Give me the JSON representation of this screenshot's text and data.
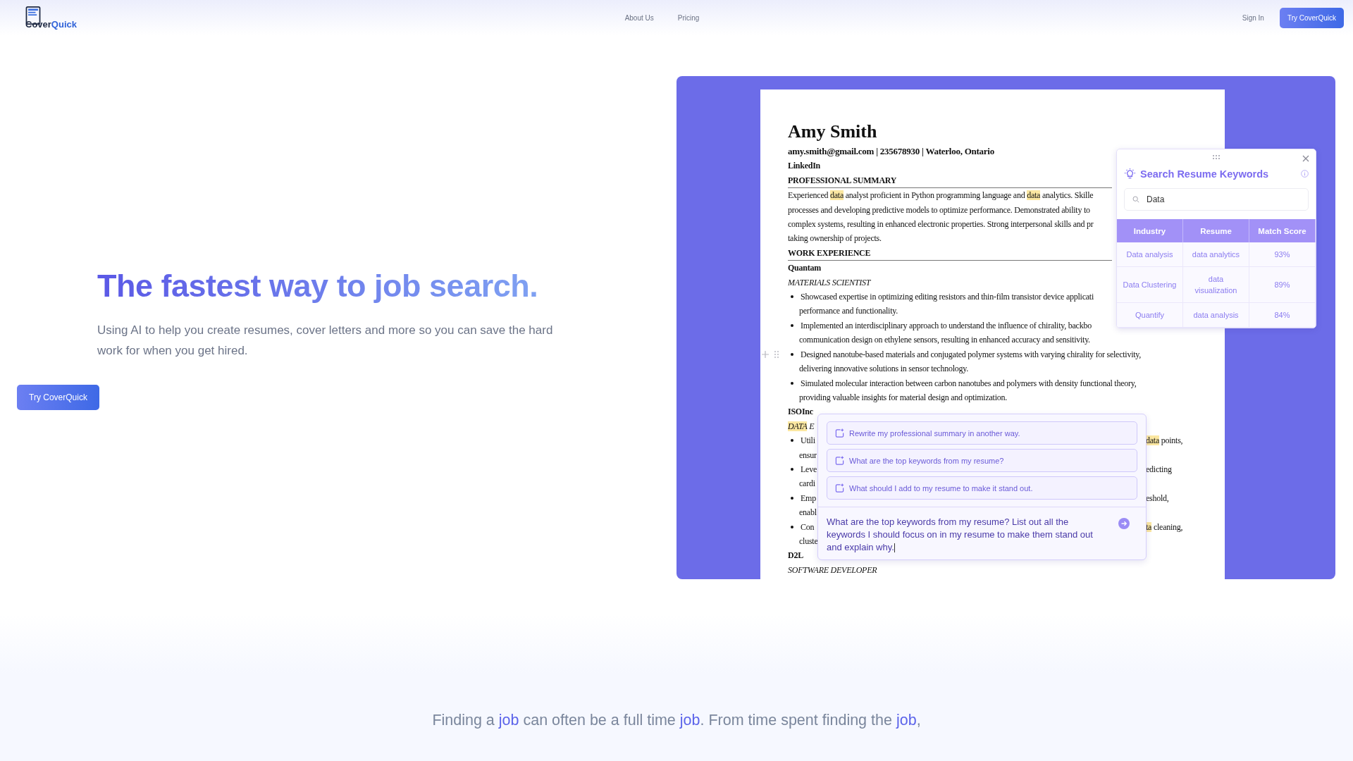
{
  "header": {
    "logo": [
      {
        "text": "Cover",
        "accent": false
      },
      {
        "text": "Quick",
        "accent": true
      }
    ],
    "nav": [
      "About Us",
      "Pricing"
    ],
    "sign_in": "Sign In",
    "cta": "Try CoverQuick"
  },
  "hero": {
    "title": "The fastest way to job search.",
    "subtitle": "Using AI to help you create resumes, cover letters and more so you can save the hard work for when you get hired.",
    "cta": "Try CoverQuick"
  },
  "resume": {
    "lines": [
      {
        "kind": "name",
        "text": "Amy Smith"
      },
      {
        "kind": "contact",
        "text": "amy.smith@gmail.com | 235678930 | Waterloo, Ontario"
      },
      {
        "kind": "contact",
        "text": "LinkedIn"
      },
      {
        "kind": "heading",
        "text": "PROFESSIONAL SUMMARY"
      },
      {
        "kind": "text",
        "segments": [
          {
            "text": "Experienced ",
            "highlighted": false
          },
          {
            "text": "data",
            "highlighted": true
          },
          {
            "text": " analyst proficient in Python programming language and ",
            "highlighted": false
          },
          {
            "text": "data",
            "highlighted": true
          },
          {
            "text": " analytics. Skille",
            "highlighted": false
          }
        ]
      },
      {
        "kind": "text",
        "text": "processes and developing predictive models to optimize performance. Demonstrated ability to"
      },
      {
        "kind": "text",
        "text": "complex systems, resulting in enhanced electronic properties. Strong interpersonal skills and pr"
      },
      {
        "kind": "text",
        "text": "taking ownership of projects."
      },
      {
        "kind": "heading",
        "text": "WORK EXPERIENCE"
      },
      {
        "kind": "company",
        "text": "Quantam"
      },
      {
        "kind": "role",
        "text": "MATERIALS SCIENTIST"
      },
      {
        "kind": "bullet",
        "text": "Showcased expertise in optimizing editing resistors and thin-film transistor device applicati"
      },
      {
        "kind": "continuation",
        "text": "performance and functionality."
      },
      {
        "kind": "bullet",
        "text": "Implemented an interdisciplinary approach to understand the influence of chirality, backbo"
      },
      {
        "kind": "continuation",
        "text": "communication design on ethylene sensors, resulting in enhanced accuracy and sensitivity."
      },
      {
        "kind": "bullet",
        "text": "Designed nanotube-based materials and conjugated polymer systems with varying chirality for selectivity,",
        "handles": true
      },
      {
        "kind": "continuation",
        "text": "delivering innovative solutions in sensor technology."
      },
      {
        "kind": "bullet",
        "text": "Simulated molecular interaction between carbon nanotubes and polymers with density functional theory,"
      },
      {
        "kind": "continuation",
        "text": "providing valuable insights for material design and optimization."
      },
      {
        "kind": "company",
        "text": "ISOInc"
      },
      {
        "kind": "role",
        "segments": [
          {
            "text": "DATA",
            "highlighted": true
          },
          {
            "text": " E",
            "highlighted": false
          }
        ]
      },
      {
        "kind": "bullet",
        "text": "Utili",
        "right": [
          {
            "text": "data",
            "highlighted": true
          },
          {
            "text": " points,",
            "highlighted": false
          }
        ]
      },
      {
        "kind": "continuation",
        "text": "ensur"
      },
      {
        "kind": "bullet",
        "text": "Leve",
        "right": [
          {
            "text": "edicting",
            "highlighted": false
          }
        ]
      },
      {
        "kind": "continuation",
        "text": "cardi"
      },
      {
        "kind": "bullet",
        "text": "Emp",
        "right": [
          {
            "text": "eshold,",
            "highlighted": false
          }
        ]
      },
      {
        "kind": "continuation",
        "text": "enabl"
      },
      {
        "kind": "bullet",
        "text": "Con",
        "right": [
          {
            "text": "ta",
            "highlighted": true
          },
          {
            "text": " cleaning,",
            "highlighted": false
          }
        ]
      },
      {
        "kind": "continuation",
        "text": "cluste"
      },
      {
        "kind": "company",
        "text": "D2L"
      },
      {
        "kind": "role",
        "text": "SOFTWARE DEVELOPER"
      }
    ]
  },
  "keywords_panel": {
    "title": "Search Resume Keywords",
    "search": {
      "value": "Data"
    },
    "table": {
      "columns": [
        "Industry",
        "Resume",
        "Match Score"
      ],
      "rows": [
        [
          "Data analysis",
          "data analytics",
          "93%"
        ],
        [
          "Data Clustering",
          "data visualization",
          "89%"
        ],
        [
          "Quantify",
          "data analysis",
          "84%"
        ]
      ]
    }
  },
  "assistant": {
    "suggestions": [
      "Rewrite my professional summary in another way.",
      "What are the top keywords from my resume?",
      "What should I add to my resume to make it stand out."
    ],
    "prompt": {
      "value": "What are the top keywords from my resume? List out all the keywords I should focus on in my resume to make them stand out and explain why."
    }
  },
  "bottom": {
    "segments": [
      {
        "text": "Finding a ",
        "accent": false
      },
      {
        "text": "job",
        "accent": true
      },
      {
        "text": " can often be a full time ",
        "accent": false
      },
      {
        "text": "job",
        "accent": true
      },
      {
        "text": ". From time spent finding the ",
        "accent": false
      },
      {
        "text": "job",
        "accent": true
      },
      {
        "text": ",",
        "accent": false
      }
    ]
  }
}
